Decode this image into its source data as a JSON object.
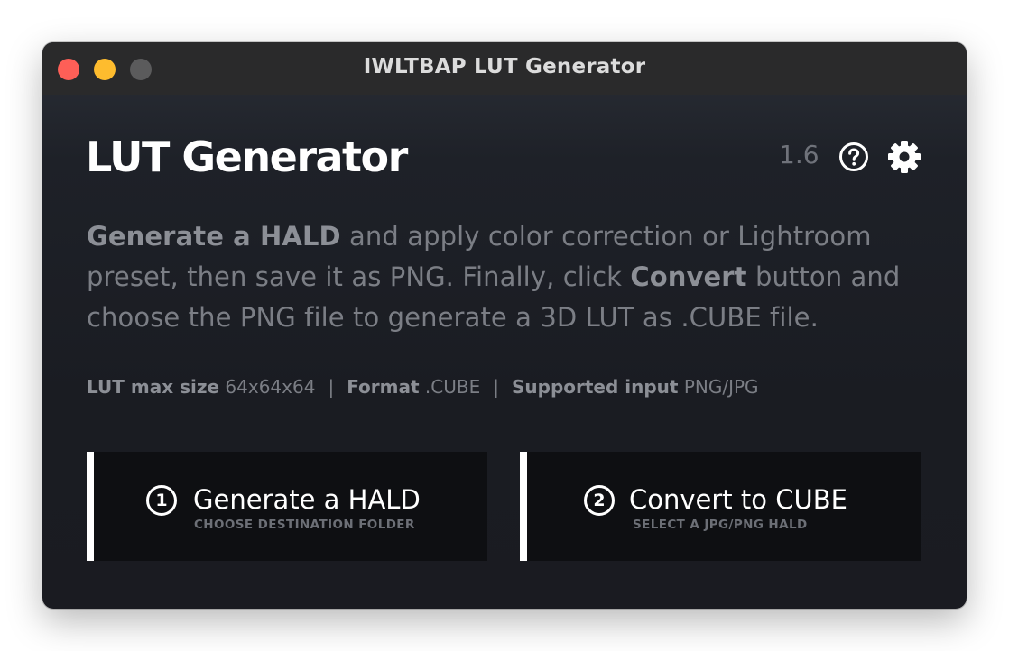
{
  "window": {
    "title": "IWLTBAP LUT Generator"
  },
  "header": {
    "title": "LUT Generator",
    "version": "1.6",
    "help_icon": "help-circle-icon",
    "settings_icon": "gear-icon"
  },
  "description": {
    "bold_1": "Generate a HALD",
    "text_1": " and apply color correction or Lightroom preset, then save it as PNG. Finally, click ",
    "bold_2": "Convert",
    "text_2": " button and choose the PNG file to generate a 3D LUT as .CUBE file."
  },
  "specs": {
    "lut_max_size_label": "LUT max size",
    "lut_max_size_value": "64x64x64",
    "separator": "|",
    "format_label": "Format",
    "format_value": ".CUBE",
    "supported_input_label": "Supported input",
    "supported_input_value": "PNG/JPG"
  },
  "actions": [
    {
      "number": "1",
      "label": "Generate a HALD",
      "sublabel": "CHOOSE DESTINATION FOLDER"
    },
    {
      "number": "2",
      "label": "Convert to CUBE",
      "sublabel": "SELECT A JPG/PNG HALD"
    }
  ],
  "colors": {
    "close": "#fe5f57",
    "minimize": "#febc2e",
    "zoom_disabled": "#5b5b5c",
    "accent_bar": "#ffffff",
    "button_bg": "#0e0f12"
  }
}
